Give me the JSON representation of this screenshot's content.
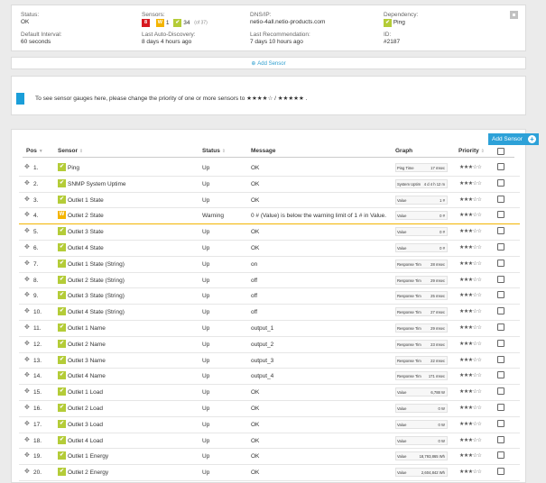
{
  "header": {
    "status_label": "Status:",
    "status_value": "OK",
    "interval_label": "Default Interval:",
    "interval_value": "60 seconds",
    "sensors_label": "Sensors:",
    "sensor_counts": {
      "down": "8",
      "warning": "1",
      "up": "34",
      "total": "(of 37)"
    },
    "discovery_label": "Last Auto-Discovery:",
    "discovery_value": "8 days 4 hours ago",
    "dns_label": "DNS/IP:",
    "dns_value": "netio-4all.netio-products.com",
    "recommendation_label": "Last Recommendation:",
    "recommendation_value": "7 days 10 hours ago",
    "dependency_label": "Dependency:",
    "dependency_value": "Ping",
    "id_label": "ID:",
    "id_value": "#2187"
  },
  "add_sensor_link": "Add Sensor",
  "gauge_note": "To see sensor gauges here, please change the priority of one or more sensors to ★★★★☆ / ★★★★★ .",
  "add_sensor_button": "Add Sensor",
  "table": {
    "columns": [
      "Pos",
      "Sensor",
      "Status",
      "Message",
      "Graph",
      "Priority"
    ],
    "rows": [
      {
        "pos": "1.",
        "name": "Ping",
        "status": "Up",
        "message": "OK",
        "graph_label": "Ping Time",
        "graph_value": "17 msec",
        "state": "up"
      },
      {
        "pos": "2.",
        "name": "SNMP System Uptime",
        "status": "Up",
        "message": "OK",
        "graph_label": "System Uptim",
        "graph_value": "4 d 4 h 12 m",
        "state": "up"
      },
      {
        "pos": "3.",
        "name": "Outlet 1 State",
        "status": "Up",
        "message": "OK",
        "graph_label": "Value",
        "graph_value": "1 #",
        "state": "up"
      },
      {
        "pos": "4.",
        "name": "Outlet 2 State",
        "status": "Warning",
        "message": "0 # (Value) is below the warning limit of 1 # in Value. O...",
        "graph_label": "Value",
        "graph_value": "0 #",
        "state": "warning"
      },
      {
        "pos": "5.",
        "name": "Outlet 3 State",
        "status": "Up",
        "message": "OK",
        "graph_label": "Value",
        "graph_value": "0 #",
        "state": "up"
      },
      {
        "pos": "6.",
        "name": "Outlet 4 State",
        "status": "Up",
        "message": "OK",
        "graph_label": "Value",
        "graph_value": "0 #",
        "state": "up"
      },
      {
        "pos": "7.",
        "name": "Outlet 1 State (String)",
        "status": "Up",
        "message": "on",
        "graph_label": "Response Tim",
        "graph_value": "28 msec",
        "state": "up"
      },
      {
        "pos": "8.",
        "name": "Outlet 2 State (String)",
        "status": "Up",
        "message": "off",
        "graph_label": "Response Tim",
        "graph_value": "29 msec",
        "state": "up"
      },
      {
        "pos": "9.",
        "name": "Outlet 3 State (String)",
        "status": "Up",
        "message": "off",
        "graph_label": "Response Tim",
        "graph_value": "25 msec",
        "state": "up"
      },
      {
        "pos": "10.",
        "name": "Outlet 4 State (String)",
        "status": "Up",
        "message": "off",
        "graph_label": "Response Tim",
        "graph_value": "27 msec",
        "state": "up"
      },
      {
        "pos": "11.",
        "name": "Outlet 1 Name",
        "status": "Up",
        "message": "output_1",
        "graph_label": "Response Tim",
        "graph_value": "29 msec",
        "state": "up"
      },
      {
        "pos": "12.",
        "name": "Outlet 2 Name",
        "status": "Up",
        "message": "output_2",
        "graph_label": "Response Tim",
        "graph_value": "23 msec",
        "state": "up"
      },
      {
        "pos": "13.",
        "name": "Outlet 3 Name",
        "status": "Up",
        "message": "output_3",
        "graph_label": "Response Tim",
        "graph_value": "22 msec",
        "state": "up"
      },
      {
        "pos": "14.",
        "name": "Outlet 4 Name",
        "status": "Up",
        "message": "output_4",
        "graph_label": "Response Tim",
        "graph_value": "171 msec",
        "state": "up"
      },
      {
        "pos": "15.",
        "name": "Outlet 1 Load",
        "status": "Up",
        "message": "OK",
        "graph_label": "Value",
        "graph_value": "6,788 W",
        "state": "up"
      },
      {
        "pos": "16.",
        "name": "Outlet 2 Load",
        "status": "Up",
        "message": "OK",
        "graph_label": "Value",
        "graph_value": "0 W",
        "state": "up"
      },
      {
        "pos": "17.",
        "name": "Outlet 3 Load",
        "status": "Up",
        "message": "OK",
        "graph_label": "Value",
        "graph_value": "0 W",
        "state": "up"
      },
      {
        "pos": "18.",
        "name": "Outlet 4 Load",
        "status": "Up",
        "message": "OK",
        "graph_label": "Value",
        "graph_value": "0 W",
        "state": "up"
      },
      {
        "pos": "19.",
        "name": "Outlet 1 Energy",
        "status": "Up",
        "message": "OK",
        "graph_label": "Value",
        "graph_value": "18,793,865 Wh",
        "state": "up"
      },
      {
        "pos": "20.",
        "name": "Outlet 2 Energy",
        "status": "Up",
        "message": "OK",
        "graph_label": "Value",
        "graph_value": "2,604,842 Wh",
        "state": "up"
      }
    ],
    "priority_stars": "★★★☆☆"
  },
  "colors": {
    "up": "#b4cc38",
    "warning": "#f4b400",
    "down": "#d71920",
    "accent": "#2da1d8"
  }
}
